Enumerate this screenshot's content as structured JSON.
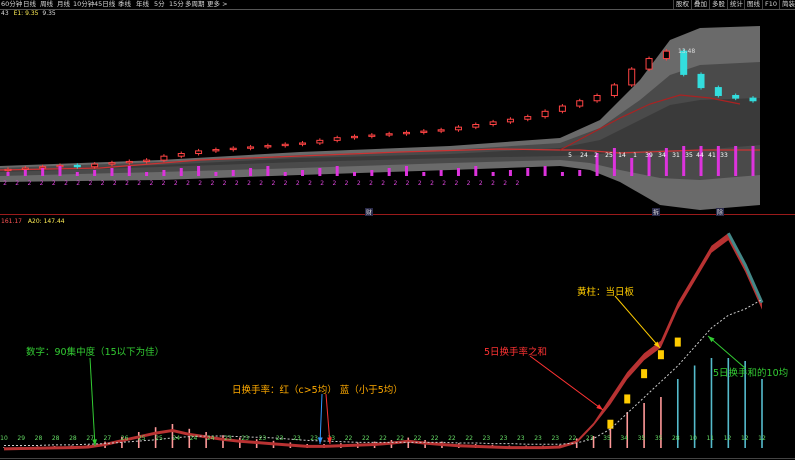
{
  "toolbar": {
    "left": [
      "60分钟",
      "日线",
      "周线",
      "月线",
      "10分钟",
      "45日线",
      "季线",
      "年线",
      "5分",
      "15分",
      "多周期",
      "更多 >"
    ],
    "right": [
      "股权",
      "叠加",
      "多股",
      "统计",
      "图线",
      "F10",
      "简装",
      "标记"
    ]
  },
  "ma_info": {
    "a": "43",
    "b": "E1: 9.35",
    "c": "9.35"
  },
  "vol_info": {
    "a": "161.17",
    "b": "A20: 147.44"
  },
  "price_labels": {
    "high": "13.48"
  },
  "markers": [
    "财",
    "拆",
    "除"
  ],
  "annotations": {
    "concentration": "数字：90集中度（15以下为佳）",
    "turnover": "日换手率：红（c>5均） 蓝（小于5均）",
    "sum5": "5日换手率之和",
    "yellow_bar": "黄柱：当日板",
    "ma10": "5日换手和的10均"
  },
  "colors": {
    "concentration": "#33cc33",
    "turnover": "#ffaa00",
    "sum5": "#ff3333",
    "yellow": "#ffcc00",
    "ma10": "#33cc33"
  },
  "chart_data": [
    {
      "type": "candlestick",
      "concentration_upper": [
        "2",
        "2",
        "2",
        "2",
        "2",
        "2",
        "2",
        "2",
        "2",
        "2",
        "2",
        "2",
        "2",
        "2",
        "2",
        "2",
        "2",
        "2",
        "2",
        "2",
        "2",
        "2",
        "2",
        "2",
        "2",
        "2",
        "2",
        "2",
        "2",
        "2",
        "2",
        "2",
        "2",
        "2",
        "2",
        "2",
        "2",
        "2",
        "2",
        "2",
        "2",
        "2",
        "2"
      ],
      "concentration_lower": [
        "5",
        "24",
        "2",
        "25",
        "14",
        "1",
        "39",
        "34",
        "31",
        "35",
        "44",
        "41",
        "33"
      ],
      "closes": [
        9.0,
        9.05,
        9.1,
        9.15,
        9.1,
        9.2,
        9.25,
        9.3,
        9.35,
        9.5,
        9.6,
        9.7,
        9.75,
        9.8,
        9.85,
        9.9,
        9.95,
        10.0,
        10.1,
        10.2,
        10.25,
        10.3,
        10.35,
        10.4,
        10.45,
        10.5,
        10.6,
        10.7,
        10.8,
        10.9,
        11.0,
        11.2,
        11.4,
        11.6,
        11.8,
        12.2,
        12.8,
        13.2,
        13.48,
        12.6,
        12.1,
        11.8,
        11.7,
        11.6
      ]
    },
    {
      "type": "bar",
      "bottom_labels": [
        "10",
        "29",
        "28",
        "28",
        "28",
        "27",
        "27",
        "26",
        "25",
        "25",
        "24",
        "24",
        "24",
        "23",
        "23",
        "23",
        "23",
        "23",
        "23",
        "23",
        "22",
        "22",
        "22",
        "22",
        "22",
        "22",
        "22",
        "22",
        "23",
        "23",
        "23",
        "23",
        "23",
        "22",
        "23",
        "35",
        "34",
        "35",
        "35",
        "28",
        "10",
        "11",
        "12",
        "12",
        "12"
      ],
      "sum5": [
        1,
        1.5,
        2,
        2.5,
        3,
        4,
        8,
        14,
        20,
        26,
        30,
        24,
        20,
        16,
        13,
        11,
        9,
        7,
        5,
        5,
        6,
        7,
        8,
        10,
        13,
        10,
        8,
        6,
        5,
        4,
        3,
        3,
        3,
        4,
        12,
        40,
        80,
        120,
        150,
        170,
        230,
        275,
        320,
        340,
        290,
        230
      ],
      "ma10_of_sum5": [
        4,
        4,
        4,
        5,
        5,
        6,
        7,
        9,
        11,
        13,
        16,
        18,
        19,
        19,
        18,
        17,
        16,
        14,
        12,
        11,
        10,
        9,
        9,
        9,
        9,
        9,
        9,
        8,
        8,
        7,
        7,
        6,
        6,
        6,
        8,
        15,
        30,
        55,
        80,
        105,
        130,
        160,
        190,
        210,
        220,
        235
      ]
    }
  ]
}
